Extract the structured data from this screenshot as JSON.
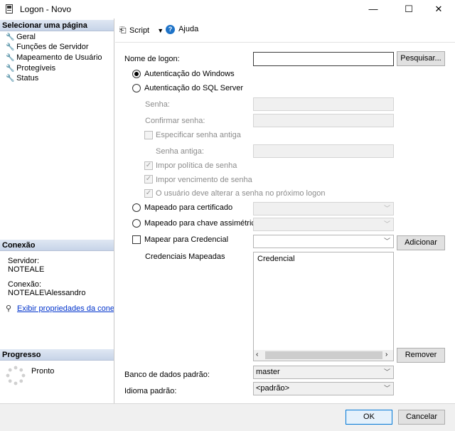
{
  "window": {
    "title": "Logon - Novo",
    "controls": {
      "minimize": "—",
      "maximize": "☐",
      "close": "✕"
    }
  },
  "left": {
    "select_page": {
      "heading": "Selecionar uma página",
      "items": [
        {
          "label": "Geral"
        },
        {
          "label": "Funções de Servidor"
        },
        {
          "label": "Mapeamento de Usuário"
        },
        {
          "label": "Protegíveis"
        },
        {
          "label": "Status"
        }
      ]
    },
    "connection": {
      "heading": "Conexão",
      "server_label": "Servidor:",
      "server_value": "NOTEALE",
      "connection_label": "Conexão:",
      "connection_value": "NOTEALE\\Alessandro",
      "link": "Exibir propriedades da conexão"
    },
    "progress": {
      "heading": "Progresso",
      "status": "Pronto"
    }
  },
  "toolbar": {
    "script": "Script",
    "help": "Ajuda"
  },
  "form": {
    "login_name_label": "Nome de logon:",
    "login_name_value": "",
    "search_button": "Pesquisar...",
    "windows_auth": "Autenticação do Windows",
    "sql_auth": "Autenticação do SQL Server",
    "password_label": "Senha:",
    "confirm_password_label": "Confirmar senha:",
    "specify_old_password": "Especificar senha antiga",
    "old_password_label": "Senha antiga:",
    "enforce_policy": "Impor política de senha",
    "enforce_expiration": "Impor vencimento de senha",
    "must_change": "O usuário deve alterar a senha no próximo logon",
    "cert_mapped": "Mapeado para certificado",
    "asym_key_mapped": "Mapeado para chave assimétrica",
    "map_credential": "Mapear para Credencial",
    "add_button": "Adicionar",
    "mapped_credentials_label": "Credenciais Mapeadas",
    "credentials_header": "Credencial",
    "remove_button": "Remover",
    "default_db_label": "Banco de dados padrão:",
    "default_db_value": "master",
    "default_lang_label": "Idioma padrão:",
    "default_lang_value": "<padrão>"
  },
  "footer": {
    "ok": "OK",
    "cancel": "Cancelar"
  },
  "colors": {
    "accent": "#0078d7",
    "link": "#0033cc",
    "disabled_text": "#8c8c8c"
  }
}
